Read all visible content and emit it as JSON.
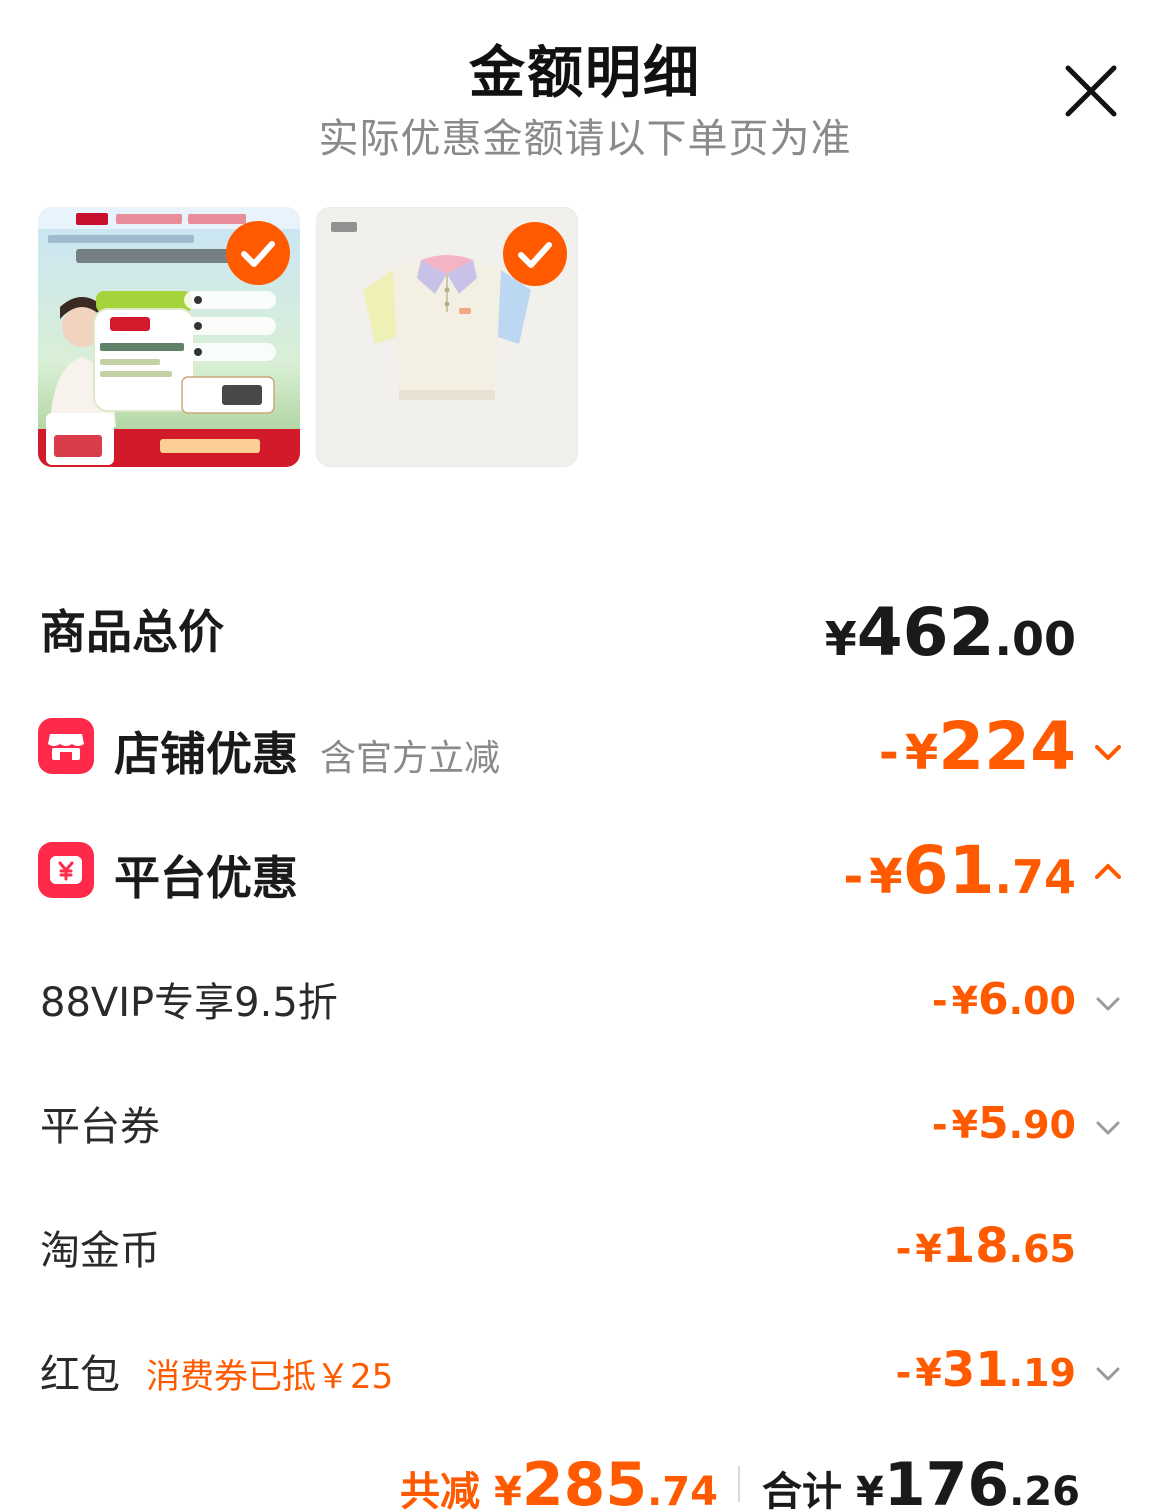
{
  "header": {
    "title": "金额明细",
    "subtitle": "实际优惠金额请以下单页为准"
  },
  "total": {
    "label": "商品总价",
    "currency": "¥",
    "int": "462",
    "dec": ".00"
  },
  "shop_discount": {
    "label": "店铺优惠",
    "note": "含官方立减",
    "prefix": "-",
    "currency": "¥",
    "int": "224",
    "dec": ""
  },
  "platform_discount": {
    "label": "平台优惠",
    "prefix": "-",
    "currency": "¥",
    "int": "61",
    "dec": ".74"
  },
  "details": [
    {
      "label": "88VIP专享9.5折",
      "prefix": "-",
      "currency": "¥",
      "int": "6",
      "dec": ".00"
    },
    {
      "label": "平台券",
      "prefix": "-",
      "currency": "¥",
      "int": "5",
      "dec": ".90"
    },
    {
      "label": "淘金币",
      "prefix": "-",
      "currency": "¥",
      "int": "18",
      "dec": ".65"
    },
    {
      "label": "红包",
      "note": "消费券已抵￥25",
      "prefix": "-",
      "currency": "¥",
      "int": "31",
      "dec": ".19"
    }
  ],
  "footer": {
    "saved_label": "共减",
    "saved_currency": "¥",
    "saved_int": "285",
    "saved_dec": ".74",
    "total_label": "合计",
    "total_currency": "¥",
    "total_int": "176",
    "total_dec": ".26"
  },
  "colors": {
    "accent": "#ff5a00",
    "badge": "#ff2a4a",
    "muted": "#8a8a8a"
  },
  "icons": {
    "close": "close-icon",
    "check": "checkmark-icon",
    "shop": "shop-icon",
    "platform": "yuan-coupon-icon",
    "expand": "chevron-down-icon",
    "collapse": "chevron-up-icon"
  }
}
